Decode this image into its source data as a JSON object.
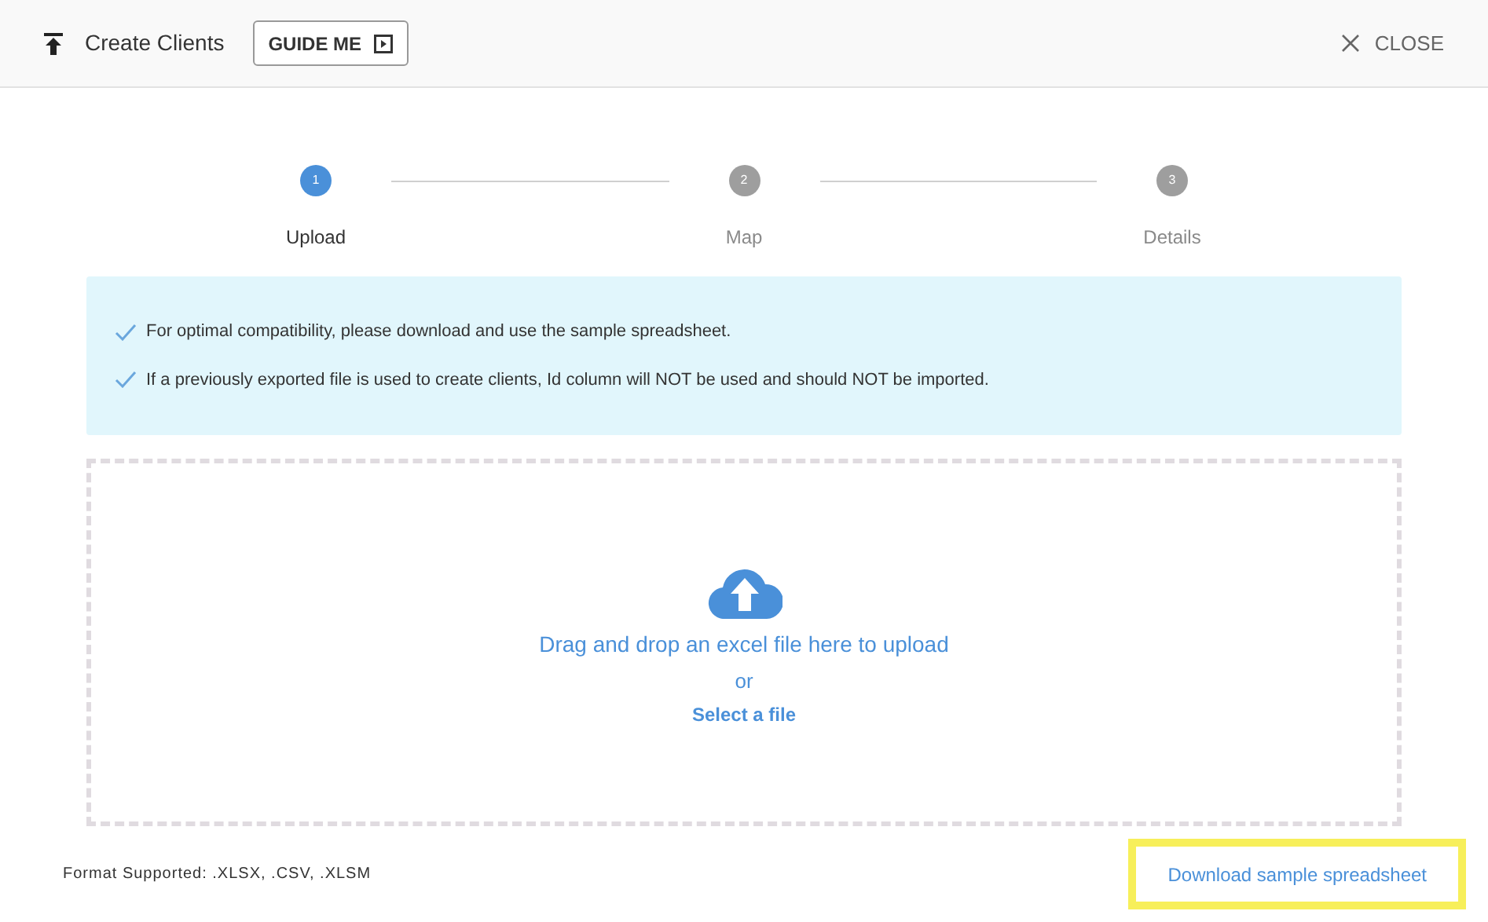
{
  "header": {
    "title": "Create Clients",
    "guide_button": "GUIDE ME",
    "close": "CLOSE"
  },
  "steps": [
    {
      "number": "1",
      "label": "Upload",
      "selected": true
    },
    {
      "number": "2",
      "label": "Map",
      "selected": false
    },
    {
      "number": "3",
      "label": "Details",
      "selected": false
    }
  ],
  "notes": [
    "For optimal compatibility, please download and use the sample spreadsheet.",
    "If a previously exported file is used to create clients, Id column will NOT be used and should NOT be imported."
  ],
  "dropzone": {
    "prompt": "Drag and drop an excel file here to upload",
    "or": "or",
    "select": "Select a file"
  },
  "footer": {
    "formats": "Format Supported: .XLSX, .CSV, .XLSM",
    "download": "Download sample spreadsheet"
  }
}
